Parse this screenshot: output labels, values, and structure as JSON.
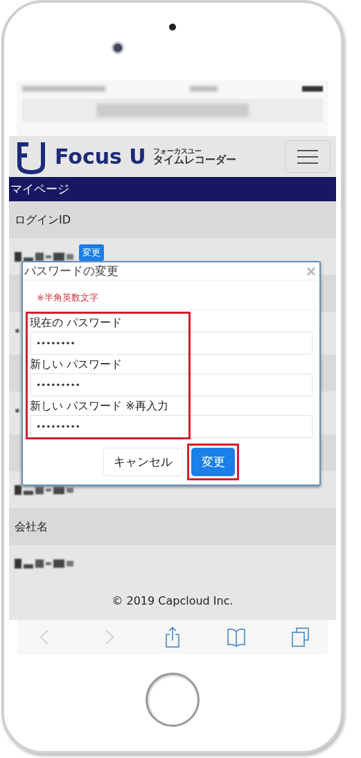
{
  "header": {
    "logo_text": "Focus U",
    "logo_ruby": "フォーカスユー",
    "logo_sub": "タイムレコーダー"
  },
  "page_title": "マイページ",
  "rows": [
    {
      "kind": "heading",
      "label": "ログインID"
    },
    {
      "kind": "value",
      "redacted": true,
      "button": "変更"
    },
    {
      "kind": "heading"
    },
    {
      "kind": "value",
      "label": "*"
    },
    {
      "kind": "heading"
    },
    {
      "kind": "value",
      "label": "*"
    },
    {
      "kind": "heading"
    },
    {
      "kind": "value",
      "redacted": true
    },
    {
      "kind": "heading",
      "label": "会社名"
    },
    {
      "kind": "value",
      "redacted": true
    }
  ],
  "footer": "© 2019 Capcloud Inc.",
  "dialog": {
    "title": "パスワードの変更",
    "note": "※半角英数文字",
    "fields": [
      {
        "label": "現在の パスワード",
        "value": "••••••••"
      },
      {
        "label": "新しい パスワード",
        "value": "•••••••••"
      },
      {
        "label": "新しい パスワード ※再入力",
        "value": "•••••••••"
      }
    ],
    "buttons": [
      {
        "kind": "secondary",
        "label": "キャンセル"
      },
      {
        "kind": "primary",
        "label": "変更"
      }
    ]
  },
  "toolbar": [
    {
      "kind": "back",
      "disabled": true
    },
    {
      "kind": "forward",
      "disabled": true
    },
    {
      "kind": "share",
      "disabled": false
    },
    {
      "kind": "bookmarks",
      "disabled": false
    },
    {
      "kind": "tabs",
      "disabled": false
    }
  ]
}
